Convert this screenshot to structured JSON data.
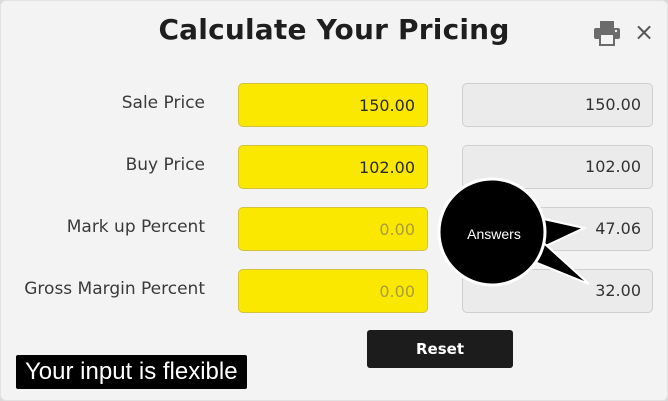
{
  "dialog": {
    "title": "Calculate Your Pricing",
    "print_icon": "printer-icon",
    "close_icon": "close-icon",
    "close_glyph": "×"
  },
  "rows": [
    {
      "label": "Sale Price",
      "input_value": "150.00",
      "input_placeholder": "",
      "output": "150.00"
    },
    {
      "label": "Buy Price",
      "input_value": "102.00",
      "input_placeholder": "",
      "output": "102.00"
    },
    {
      "label": "Mark up Percent",
      "input_value": "",
      "input_placeholder": "0.00",
      "output": "47.06"
    },
    {
      "label": "Gross Margin Percent",
      "input_value": "",
      "input_placeholder": "0.00",
      "output": "32.00"
    }
  ],
  "reset_label": "Reset",
  "callout": {
    "text": "Answers"
  },
  "banner": {
    "text": "Your input is flexible"
  },
  "colors": {
    "input_bg": "#fbe800",
    "output_bg": "#ebebeb",
    "button_bg": "#1c1c1c",
    "callout_bg": "#000000"
  }
}
